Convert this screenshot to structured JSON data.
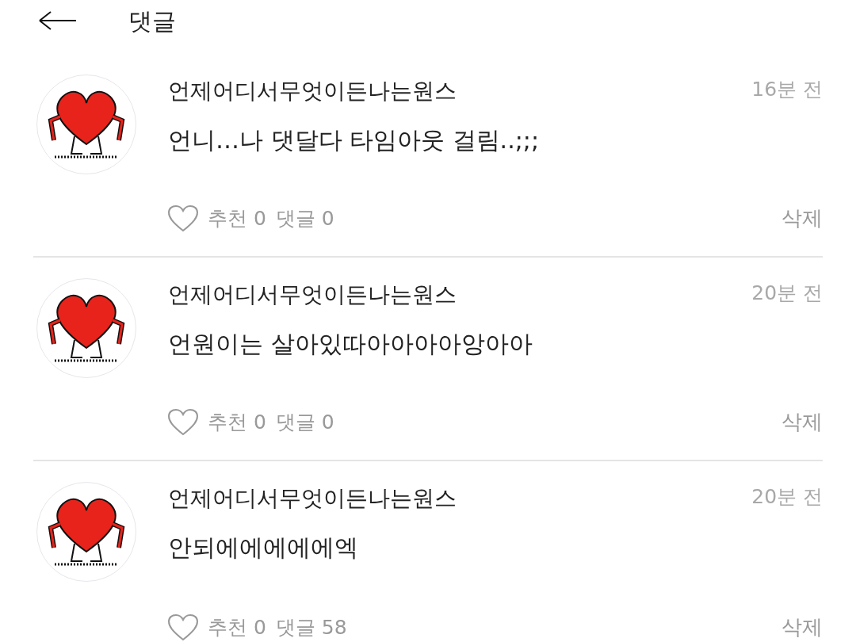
{
  "header": {
    "title": "댓글"
  },
  "comments": [
    {
      "author": "언제어디서무엇이든나는원스",
      "time": "16분 전",
      "text": "언니…나 댓달다 타임아웃 걸림..;;;",
      "likes": "추천 0",
      "replies": "댓글 0",
      "liked": false,
      "delete": "삭제"
    },
    {
      "author": "언제어디서무엇이든나는원스",
      "time": "20분 전",
      "text": "언원이는 살아있따아아아아앙아아",
      "likes": "추천 0",
      "replies": "댓글 0",
      "liked": false,
      "delete": "삭제"
    },
    {
      "author": "언제어디서무엇이든나는원스",
      "time": "20분 전",
      "text": "안되에에에에에엑",
      "likes": "추천 0",
      "replies": "댓글 58",
      "liked": false,
      "delete": "삭제"
    }
  ]
}
